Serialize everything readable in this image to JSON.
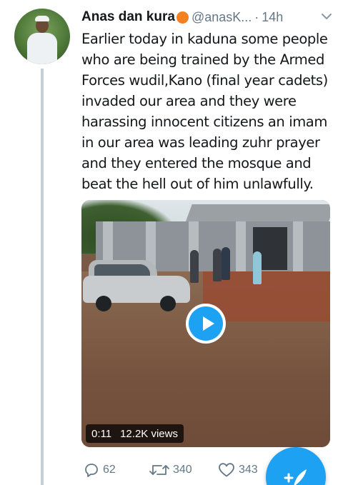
{
  "tweet": {
    "author_name": "Anas dan kura",
    "handle": "@anasK...",
    "separator": "·",
    "time": "14h",
    "text_lines": [
      "Earlier today in kaduna some people",
      "who are being trained by the Armed",
      "Forces wudil,Kano (final year cadets)",
      "invaded our area and they were",
      "harassing innocent citizens an imam",
      "in our area was leading zuhr prayer",
      "and they entered the mosque and",
      "beat the hell out of him unlawfully."
    ]
  },
  "media": {
    "type": "video",
    "duration": "0:11",
    "views": "12.2K views"
  },
  "actions": {
    "replies": "62",
    "retweets": "340",
    "likes": "343"
  },
  "icons": {
    "reply": "reply-icon",
    "retweet": "retweet-icon",
    "like": "heart-icon",
    "play": "play-icon",
    "compose": "compose-tweet-icon",
    "menu": "chevron-down-icon"
  },
  "colors": {
    "accent": "#1da1f2",
    "muted": "#657786",
    "text": "#14171a",
    "emoji_dot": "#f4801f"
  }
}
